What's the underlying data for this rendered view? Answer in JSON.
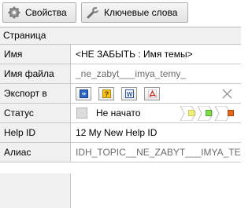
{
  "toolbar": {
    "properties_label": "Свойства",
    "keywords_label": "Ключевые слова",
    "properties_icon": "gear-icon",
    "keywords_icon": "wrench-icon"
  },
  "section": {
    "title": "Страница"
  },
  "rows": {
    "name": {
      "label": "Имя",
      "value": "<НЕ ЗАБЫТЬ : Имя темы>"
    },
    "filename": {
      "label": "Имя файла",
      "value": "_ne_zabyt___imya_temy_"
    },
    "export": {
      "label": "Экспорт в",
      "formats": [
        "chm-icon",
        "help-icon",
        "word-icon",
        "pdf-icon"
      ],
      "clear_icon": "x-icon"
    },
    "status": {
      "label": "Статус",
      "value": "Не начато",
      "colors": {
        "box": "#dcdcdc",
        "yellow": "#f2f27a",
        "green": "#7fdc4c",
        "orange": "#e8661a"
      }
    },
    "help_id": {
      "label": "Help ID",
      "value": "12 My New Help ID"
    },
    "alias": {
      "label": "Алиас",
      "value": "IDH_TOPIC__NE_ZABYT___IMYA_TE"
    }
  }
}
